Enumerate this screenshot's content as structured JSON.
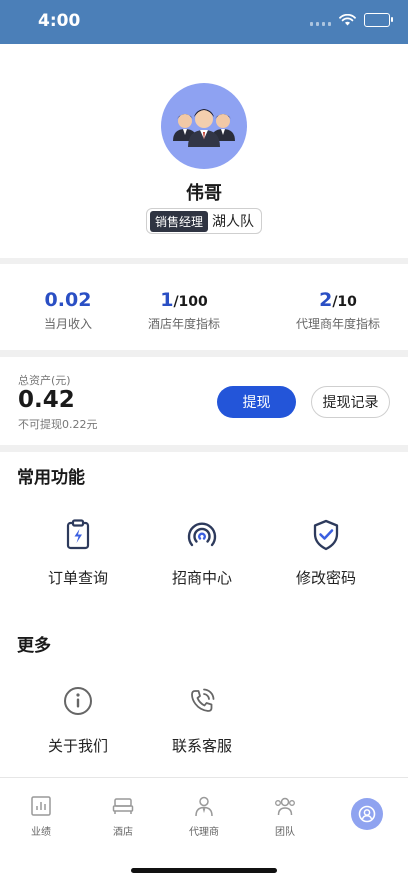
{
  "status_bar": {
    "time": "4:00"
  },
  "profile": {
    "name": "伟哥",
    "role": "销售经理",
    "team": "湖人队"
  },
  "stats": [
    {
      "value": "0.02",
      "denominator": "",
      "label": "当月收入"
    },
    {
      "value": "1",
      "denominator": "/100",
      "label": "酒店年度指标"
    },
    {
      "value": "2",
      "denominator": "/10",
      "label": "代理商年度指标"
    }
  ],
  "assets": {
    "label": "总资产(元)",
    "value": "0.42",
    "sub": "不可提现0.22元",
    "withdraw_label": "提现",
    "record_label": "提现记录"
  },
  "common": {
    "title": "常用功能",
    "items": [
      {
        "label": "订单查询",
        "icon": "clipboard-lightning-icon"
      },
      {
        "label": "招商中心",
        "icon": "signal-arcs-icon"
      },
      {
        "label": "修改密码",
        "icon": "shield-check-icon"
      }
    ]
  },
  "more": {
    "title": "更多",
    "items": [
      {
        "label": "关于我们",
        "icon": "info-icon"
      },
      {
        "label": "联系客服",
        "icon": "phone-call-icon"
      }
    ]
  },
  "tabs": [
    {
      "label": "业绩",
      "icon": "chart-icon"
    },
    {
      "label": "酒店",
      "icon": "bed-icon"
    },
    {
      "label": "代理商",
      "icon": "person-icon"
    },
    {
      "label": "团队",
      "icon": "team-icon"
    },
    {
      "label": "",
      "icon": "profile-icon",
      "active": true
    }
  ],
  "colors": {
    "status_bar": "#4b7fb8",
    "accent": "#2355d9",
    "stat_value": "#2a4fc4",
    "avatar_bg": "#8ea2f2"
  }
}
